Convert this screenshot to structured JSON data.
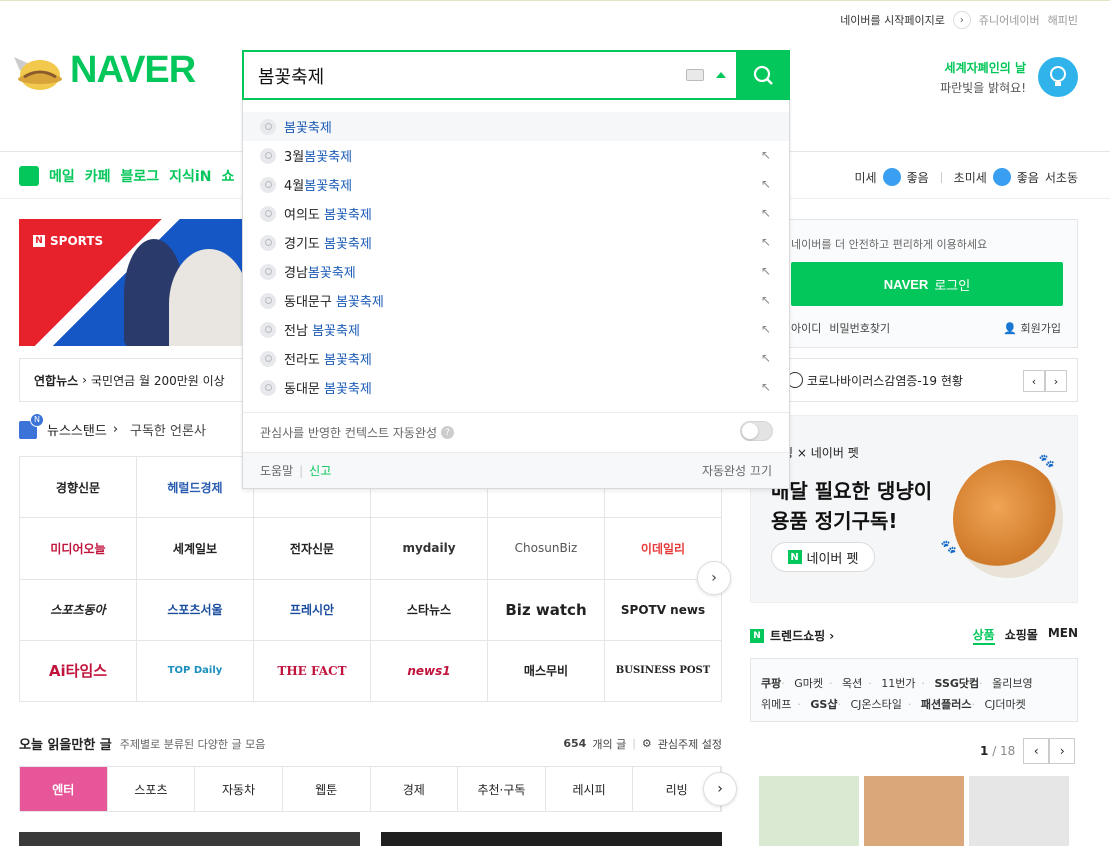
{
  "top": {
    "start_page": "네이버를 시작페이지로",
    "junior": "쥬니어네이버",
    "happybean": "해피빈"
  },
  "logo": {
    "text": "NAVER"
  },
  "search": {
    "value": "봄꽃축제"
  },
  "promo": {
    "line1": "세계자폐인의 날",
    "line2": "파란빛을 밝혀요!"
  },
  "nav": {
    "items": [
      "메일",
      "카페",
      "블로그",
      "지식iN",
      "쇼"
    ]
  },
  "weather": {
    "fine_dust_label": "미세",
    "fine_dust_status": "좋음",
    "ultrafine_label": "초미세",
    "ultrafine_status": "좋음",
    "location": "서초동"
  },
  "sports": {
    "label": "SPORTS",
    "badge": "N"
  },
  "news_headline": {
    "source": "연합뉴스",
    "text": "국민연금 월 200만원 이상"
  },
  "newsstand": {
    "title": "뉴스스탠드",
    "subscribed": "구독한 언론사",
    "badge": "N"
  },
  "press": [
    "경향신문",
    "헤럴드경제",
    "",
    "",
    "",
    "",
    "미디어오늘",
    "세계일보",
    "전자신문",
    "mydaily",
    "ChosunBiz",
    "이데일리",
    "스포츠동아",
    "스포츠서울",
    "프레시안",
    "스타뉴스",
    "Biz watch",
    "SPOTV news",
    "Ai타임스",
    "TOP Daily",
    "THE FACT",
    "news1",
    "매스무비",
    "BUSINESS POST"
  ],
  "readable": {
    "title": "오늘 읽을만한 글",
    "subtitle": "주제별로 분류된 다양한 글 모음",
    "count": "654",
    "count_unit": "개의 글",
    "settings": "관심주제 설정"
  },
  "categories": [
    "엔터",
    "스포츠",
    "자동차",
    "웹툰",
    "경제",
    "추천·구독",
    "레시피",
    "리빙"
  ],
  "login": {
    "message": "네이버를 더 안전하고 편리하게 이용하세요",
    "button_brand": "NAVER",
    "button_label": "로그인",
    "find_id": "아이디",
    "find_pw": "비밀번호찾기",
    "join": "회원가입"
  },
  "covid": {
    "text": "코로나바이러스감염증-19 현황"
  },
  "ad": {
    "line1": "쇼핑 × 네이버 펫",
    "line2a": "매달 필요한 댕냥이",
    "line2b": "용품 정기구독!",
    "pill": "네이버 펫"
  },
  "trend": {
    "title": "트렌드쇼핑",
    "tabs": [
      "상품",
      "쇼핑몰",
      "MEN"
    ]
  },
  "malls": {
    "row1": [
      "쿠팡",
      "G마켓",
      "옥션",
      "11번가",
      "SSG닷컴",
      "올리브영"
    ],
    "row2": [
      "위메프",
      "GS샵",
      "CJ온스타일",
      "패션플러스",
      "CJ더마켓"
    ]
  },
  "shop_pager": {
    "current": "1",
    "total": "/ 18"
  },
  "suggestions": [
    {
      "pre": "",
      "kw": "봄꽃축제"
    },
    {
      "pre": "3월",
      "kw": "봄꽃축제"
    },
    {
      "pre": "4월",
      "kw": "봄꽃축제"
    },
    {
      "pre": "여의도 ",
      "kw": "봄꽃축제"
    },
    {
      "pre": "경기도 ",
      "kw": "봄꽃축제"
    },
    {
      "pre": "경남",
      "kw": "봄꽃축제"
    },
    {
      "pre": "동대문구 ",
      "kw": "봄꽃축제"
    },
    {
      "pre": "전남 ",
      "kw": "봄꽃축제"
    },
    {
      "pre": "전라도 ",
      "kw": "봄꽃축제"
    },
    {
      "pre": "동대문 ",
      "kw": "봄꽃축제"
    }
  ],
  "dropdown": {
    "context_label": "관심사를 반영한 컨텍스트 자동완성",
    "help": "도움말",
    "report": "신고",
    "off": "자동완성 끄기"
  },
  "colors": {
    "brand": "#03c75a",
    "keyword": "#1b5bb8",
    "active_tab": "#e8569a"
  }
}
